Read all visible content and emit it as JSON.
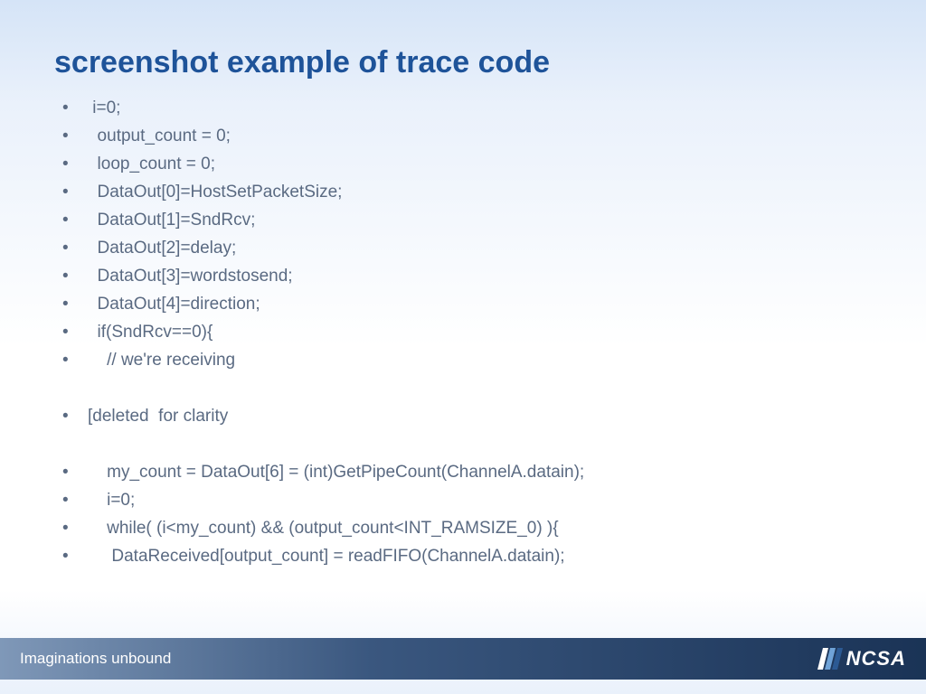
{
  "title": "screenshot example of trace code",
  "bullets": [
    {
      "text": " i=0;"
    },
    {
      "text": "  output_count = 0;"
    },
    {
      "text": "  loop_count = 0;"
    },
    {
      "text": "  DataOut[0]=HostSetPacketSize;"
    },
    {
      "text": "  DataOut[1]=SndRcv;"
    },
    {
      "text": "  DataOut[2]=delay;"
    },
    {
      "text": "  DataOut[3]=wordstosend;"
    },
    {
      "text": "  DataOut[4]=direction;"
    },
    {
      "text": "  if(SndRcv==0){"
    },
    {
      "text": "    // we're receiving"
    },
    {
      "text": "",
      "blank": true
    },
    {
      "text": "[deleted  for clarity"
    },
    {
      "text": "",
      "blank": true
    },
    {
      "text": "    my_count = DataOut[6] = (int)GetPipeCount(ChannelA.datain);"
    },
    {
      "text": "    i=0;"
    },
    {
      "text": "    while( (i<my_count) && (output_count<INT_RAMSIZE_0) ){"
    },
    {
      "text": "     DataReceived[output_count] = readFIFO(ChannelA.datain);"
    }
  ],
  "footer": {
    "tagline": "Imaginations unbound",
    "logo_text": "NCSA"
  }
}
